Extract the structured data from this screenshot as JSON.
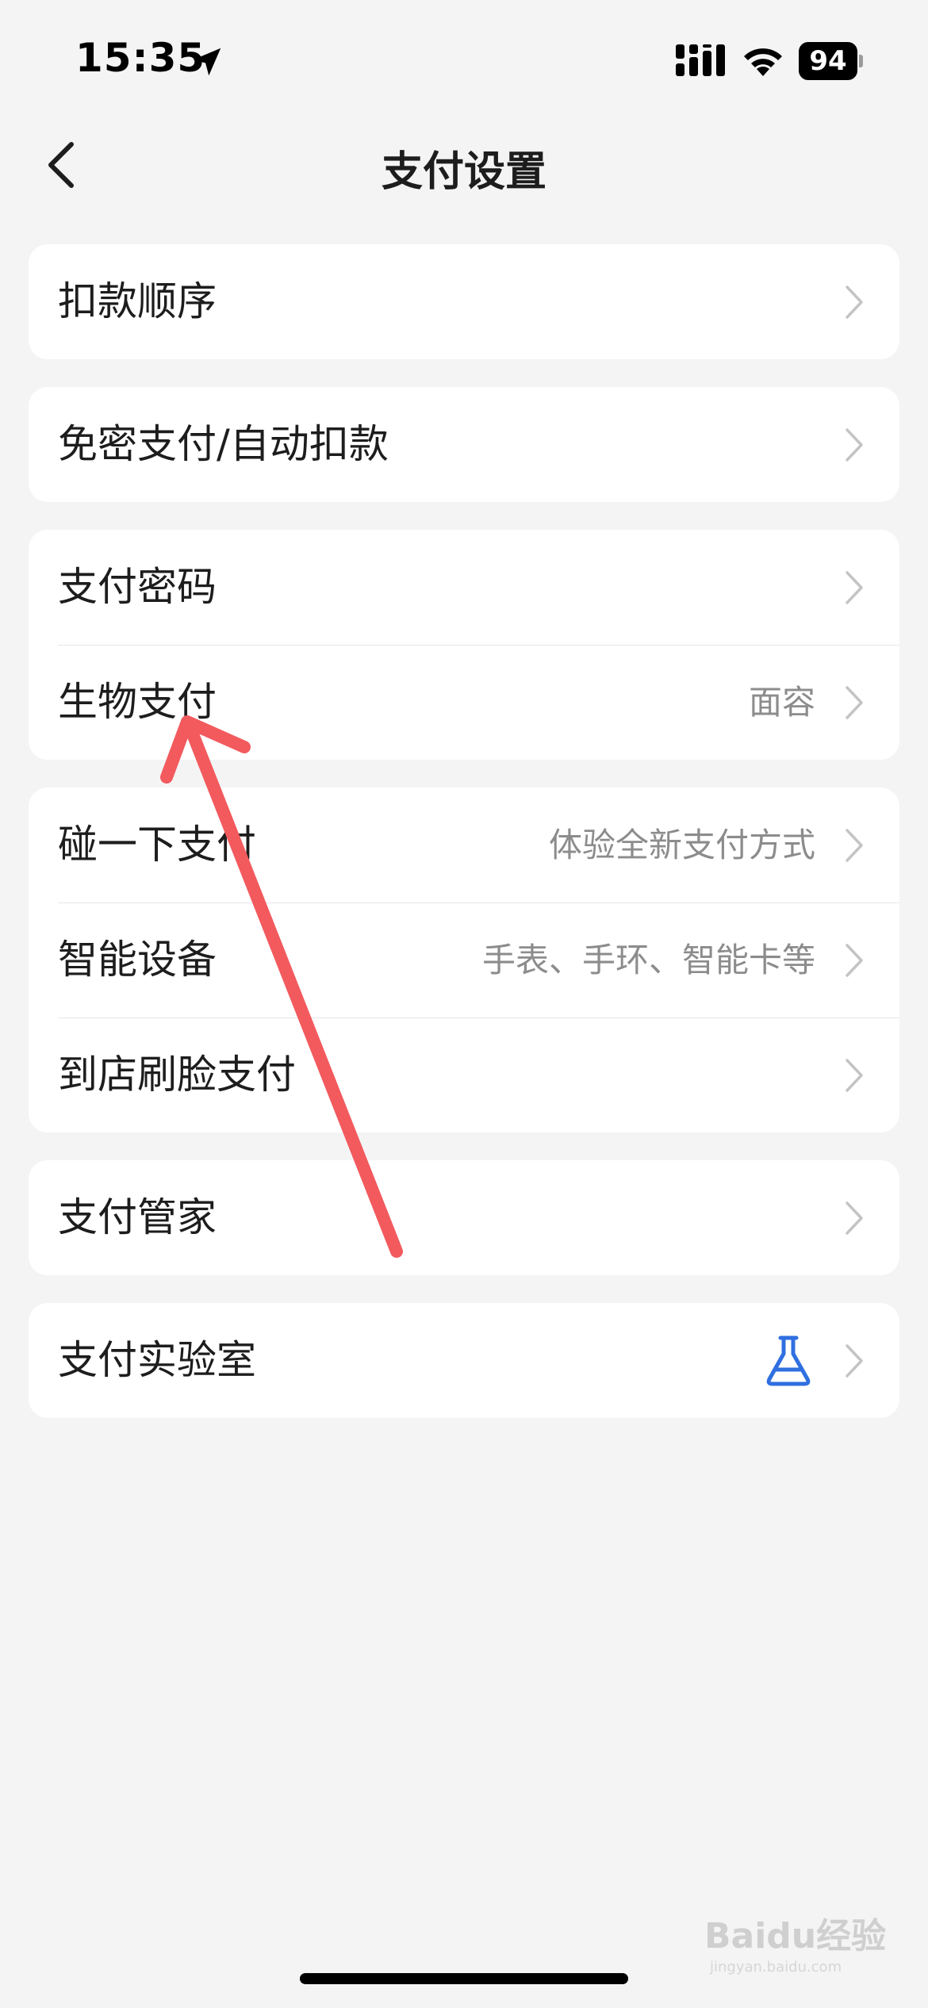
{
  "status_bar": {
    "time": "15:35",
    "battery": "94"
  },
  "header": {
    "title": "支付设置"
  },
  "groups": [
    [
      {
        "label": "扣款顺序",
        "value": ""
      }
    ],
    [
      {
        "label": "免密支付/自动扣款",
        "value": ""
      }
    ],
    [
      {
        "label": "支付密码",
        "value": ""
      },
      {
        "label": "生物支付",
        "value": "面容"
      }
    ],
    [
      {
        "label": "碰一下支付",
        "value": "体验全新支付方式"
      },
      {
        "label": "智能设备",
        "value": "手表、手环、智能卡等"
      },
      {
        "label": "到店刷脸支付",
        "value": ""
      }
    ],
    [
      {
        "label": "支付管家",
        "value": ""
      }
    ],
    [
      {
        "label": "支付实验室",
        "value": "",
        "icon": "flask-icon"
      }
    ]
  ],
  "colors": {
    "background": "#f4f4f4",
    "card": "#ffffff",
    "accent_blue": "#2f6fe0",
    "annotation_red": "#f25a5e"
  },
  "watermark": {
    "text": "Baidu经验",
    "sub": "jingyan.baidu.com"
  }
}
